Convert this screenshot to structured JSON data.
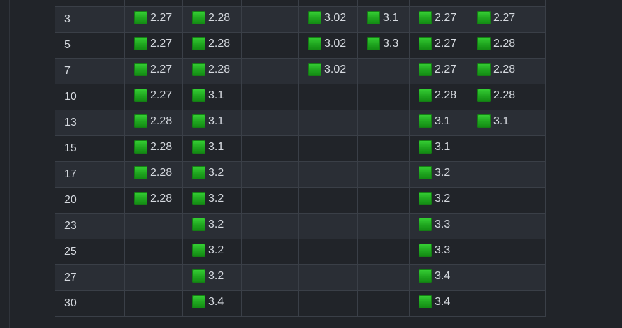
{
  "table": {
    "rows": [
      {
        "version": "",
        "cells": [
          "",
          "",
          "",
          "",
          "",
          "",
          "",
          ""
        ]
      },
      {
        "version": "3",
        "cells": [
          "2.27",
          "2.28",
          "",
          "3.02",
          "3.1",
          "2.27",
          "2.27",
          ""
        ]
      },
      {
        "version": "5",
        "cells": [
          "2.27",
          "2.28",
          "",
          "3.02",
          "3.3",
          "2.27",
          "2.28",
          ""
        ]
      },
      {
        "version": "7",
        "cells": [
          "2.27",
          "2.28",
          "",
          "3.02",
          "",
          "2.27",
          "2.28",
          ""
        ]
      },
      {
        "version": "10",
        "cells": [
          "2.27",
          "3.1",
          "",
          "",
          "",
          "2.28",
          "2.28",
          ""
        ]
      },
      {
        "version": "13",
        "cells": [
          "2.28",
          "3.1",
          "",
          "",
          "",
          "3.1",
          "3.1",
          ""
        ]
      },
      {
        "version": "15",
        "cells": [
          "2.28",
          "3.1",
          "",
          "",
          "",
          "3.1",
          "",
          ""
        ]
      },
      {
        "version": "17",
        "cells": [
          "2.28",
          "3.2",
          "",
          "",
          "",
          "3.2",
          "",
          ""
        ]
      },
      {
        "version": "20",
        "cells": [
          "2.28",
          "3.2",
          "",
          "",
          "",
          "3.2",
          "",
          ""
        ]
      },
      {
        "version": "23",
        "cells": [
          "",
          "3.2",
          "",
          "",
          "",
          "3.3",
          "",
          ""
        ]
      },
      {
        "version": "25",
        "cells": [
          "",
          "3.2",
          "",
          "",
          "",
          "3.3",
          "",
          ""
        ]
      },
      {
        "version": "27",
        "cells": [
          "",
          "3.2",
          "",
          "",
          "",
          "3.4",
          "",
          ""
        ]
      },
      {
        "version": "30",
        "cells": [
          "",
          "3.4",
          "",
          "",
          "",
          "3.4",
          "",
          ""
        ]
      }
    ],
    "status_icon": "green-square-icon",
    "colors": {
      "background": "#212429",
      "row_alt": "#2a2e35",
      "border": "#3a3f47",
      "text": "#d6dae0",
      "status_green": "#2bbf2b"
    }
  }
}
